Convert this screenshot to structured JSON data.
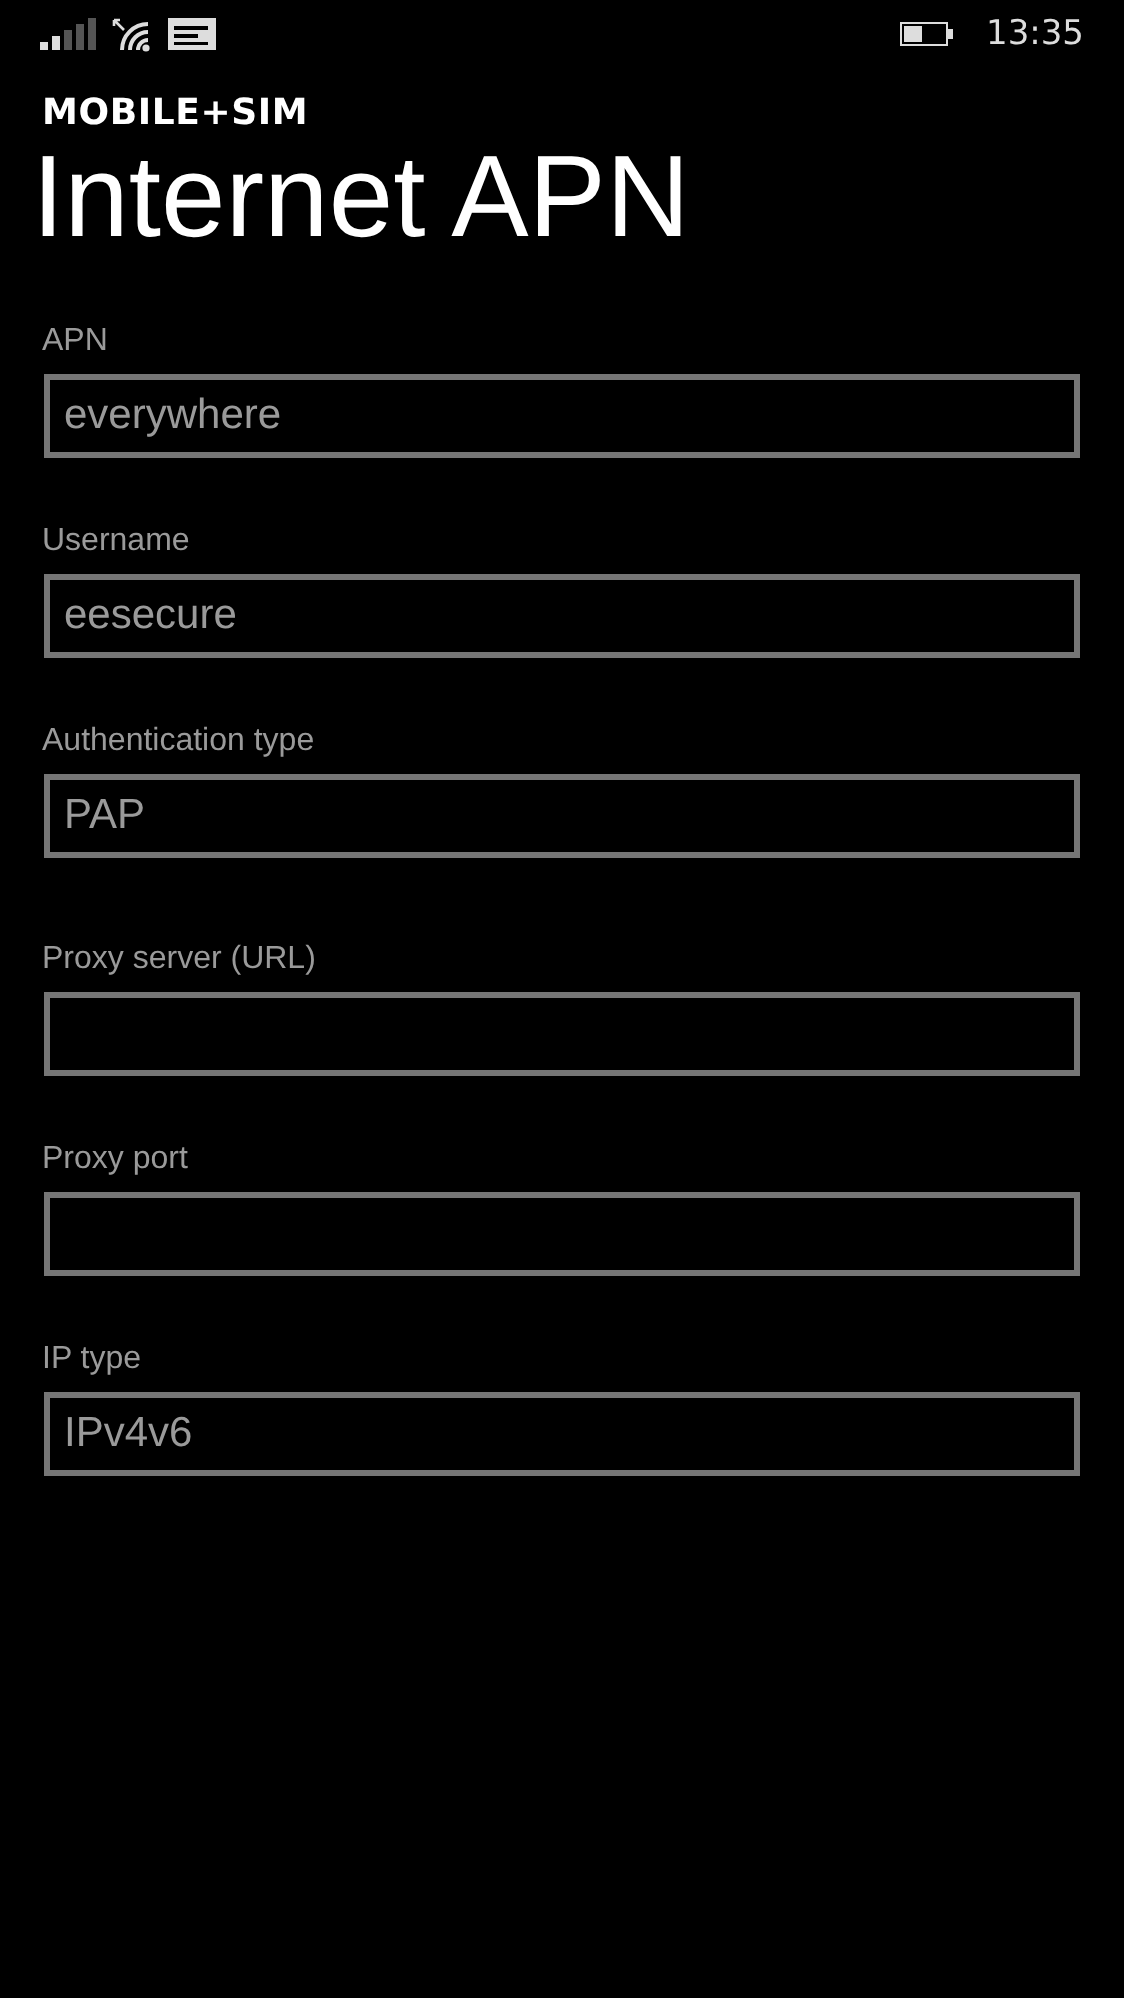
{
  "status_bar": {
    "time": "13:35"
  },
  "header": {
    "section": "MOBILE+SIM",
    "title": "Internet APN"
  },
  "groups": [
    {
      "fields": [
        {
          "label": "APN",
          "value": "everywhere"
        },
        {
          "label": "Username",
          "value": "eesecure"
        },
        {
          "label": "Authentication type",
          "value": "PAP"
        }
      ]
    },
    {
      "fields": [
        {
          "label": "Proxy server (URL)"
        },
        {
          "label": "Proxy port"
        },
        {
          "label": "IP type",
          "value": "IPv4v6"
        }
      ]
    }
  ]
}
